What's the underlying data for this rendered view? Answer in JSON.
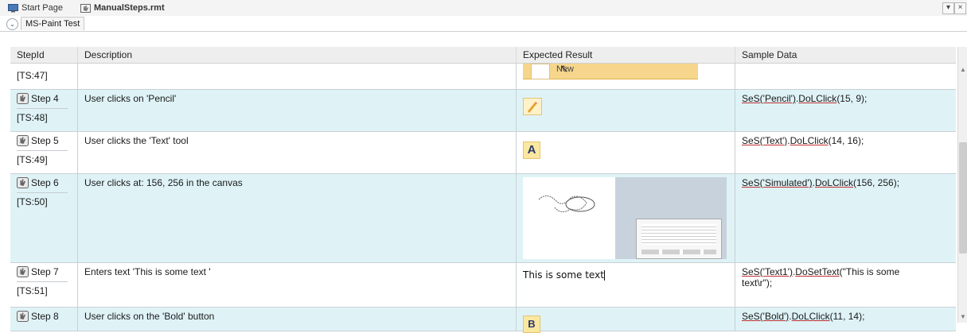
{
  "tabs": {
    "start_page": "Start Page",
    "file": "ManualSteps.rmt"
  },
  "window_controls": {
    "dropdown": "▾",
    "close": "×"
  },
  "group": {
    "name": "MS-Paint Test"
  },
  "columns": {
    "step_id": "StepId",
    "description": "Description",
    "expected": "Expected Result",
    "sample": "Sample Data"
  },
  "rows": [
    {
      "step": "",
      "ts": "[TS:47]",
      "description": "",
      "expected_text": "",
      "sample_obj": "",
      "sample_rest": "",
      "expected_kind": "menu-new",
      "menu_text": "New"
    },
    {
      "step": "Step 4",
      "ts": "[TS:48]",
      "description": "User clicks on 'Pencil'",
      "expected_text": "",
      "sample_obj": "SeS('Pencil')",
      "sample_method": "DoLClick",
      "sample_rest": "(15, 9);",
      "expected_kind": "pencil"
    },
    {
      "step": "Step 5",
      "ts": "[TS:49]",
      "description": "User clicks the 'Text' tool",
      "expected_text": "",
      "sample_obj": "SeS('Text')",
      "sample_method": "DoLClick",
      "sample_rest": "(14, 16);",
      "expected_kind": "text-tool"
    },
    {
      "step": "Step 6",
      "ts": "[TS:50]",
      "description": "User clicks at: 156, 256 in the canvas",
      "expected_text": "",
      "sample_obj": "SeS('Simulated')",
      "sample_method": "DoLClick",
      "sample_rest": "(156, 256);",
      "expected_kind": "canvas"
    },
    {
      "step": "Step 7",
      "ts": "[TS:51]",
      "description": "Enters text 'This is some text '",
      "expected_text": "This is some text",
      "sample_obj": "SeS('Text1')",
      "sample_method": "DoSetText",
      "sample_rest": "(\"This is some",
      "sample_line2": "text\\r\");",
      "expected_kind": "typed-text"
    },
    {
      "step": "Step 8",
      "ts": "",
      "description": "User clicks on the 'Bold' button",
      "expected_text": "",
      "sample_obj": "SeS('Bold')",
      "sample_method": "DoLClick",
      "sample_rest": "(11, 14);",
      "expected_kind": "bold"
    }
  ],
  "colors": {
    "row_alt": "#dff3f7",
    "header_bg": "#eeeeee",
    "underline": "#c03030"
  }
}
